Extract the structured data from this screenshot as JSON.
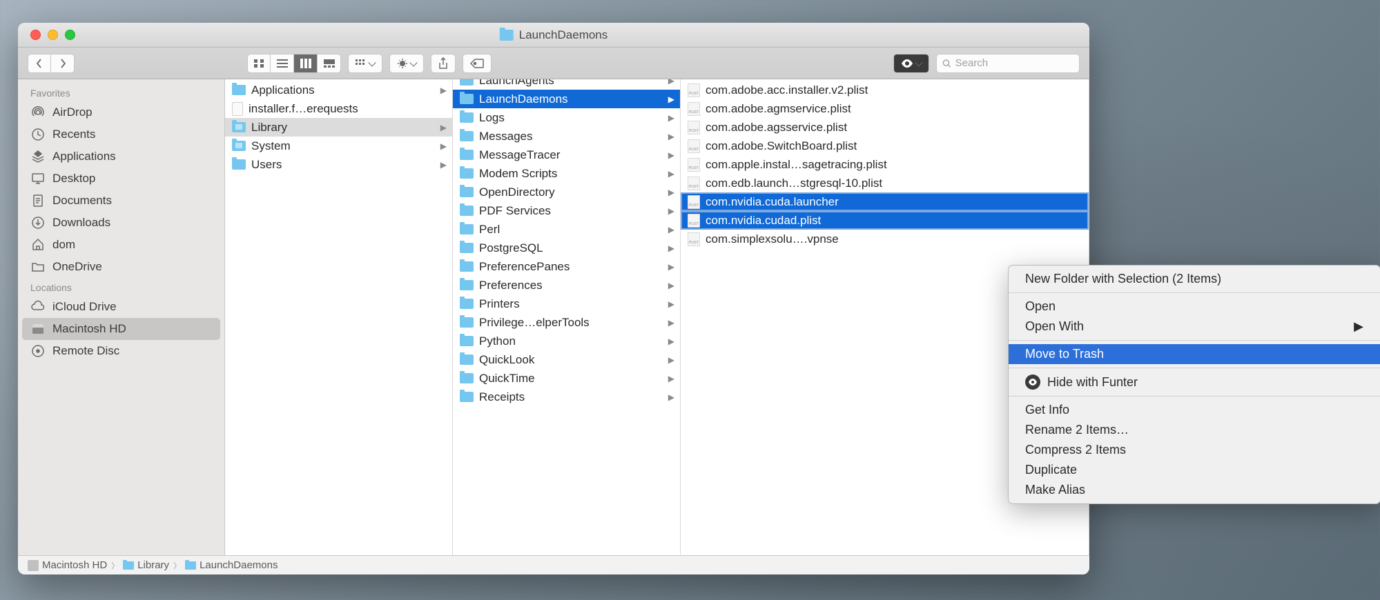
{
  "window": {
    "title": "LaunchDaemons"
  },
  "search": {
    "placeholder": "Search"
  },
  "sidebar": {
    "sections": [
      {
        "label": "Favorites",
        "items": [
          {
            "label": "AirDrop",
            "icon": "airdrop"
          },
          {
            "label": "Recents",
            "icon": "clock"
          },
          {
            "label": "Applications",
            "icon": "apps"
          },
          {
            "label": "Desktop",
            "icon": "desktop"
          },
          {
            "label": "Documents",
            "icon": "documents"
          },
          {
            "label": "Downloads",
            "icon": "downloads"
          },
          {
            "label": "dom",
            "icon": "home"
          },
          {
            "label": "OneDrive",
            "icon": "folder"
          }
        ]
      },
      {
        "label": "Locations",
        "items": [
          {
            "label": "iCloud Drive",
            "icon": "cloud"
          },
          {
            "label": "Macintosh HD",
            "icon": "disk",
            "selected": true
          },
          {
            "label": "Remote Disc",
            "icon": "remote"
          }
        ]
      }
    ]
  },
  "columns": {
    "col1": [
      {
        "label": "Applications",
        "type": "folder",
        "hasChild": true
      },
      {
        "label": "installer.f…erequests",
        "type": "file"
      },
      {
        "label": "Library",
        "type": "folder-sys",
        "hasChild": true,
        "selected": true
      },
      {
        "label": "System",
        "type": "folder-sys",
        "hasChild": true
      },
      {
        "label": "Users",
        "type": "folder",
        "hasChild": true
      }
    ],
    "col2": [
      {
        "label": "LaunchAgents",
        "type": "folder",
        "hasChild": true,
        "partial": true
      },
      {
        "label": "LaunchDaemons",
        "type": "folder",
        "hasChild": true,
        "hl": true
      },
      {
        "label": "Logs",
        "type": "folder",
        "hasChild": true
      },
      {
        "label": "Messages",
        "type": "folder",
        "hasChild": true
      },
      {
        "label": "MessageTracer",
        "type": "folder",
        "hasChild": true
      },
      {
        "label": "Modem Scripts",
        "type": "folder",
        "hasChild": true
      },
      {
        "label": "OpenDirectory",
        "type": "folder",
        "hasChild": true
      },
      {
        "label": "PDF Services",
        "type": "folder",
        "hasChild": true
      },
      {
        "label": "Perl",
        "type": "folder",
        "hasChild": true
      },
      {
        "label": "PostgreSQL",
        "type": "folder",
        "hasChild": true
      },
      {
        "label": "PreferencePanes",
        "type": "folder",
        "hasChild": true
      },
      {
        "label": "Preferences",
        "type": "folder",
        "hasChild": true
      },
      {
        "label": "Printers",
        "type": "folder",
        "hasChild": true
      },
      {
        "label": "Privilege…elperTools",
        "type": "folder",
        "hasChild": true
      },
      {
        "label": "Python",
        "type": "folder",
        "hasChild": true
      },
      {
        "label": "QuickLook",
        "type": "folder",
        "hasChild": true
      },
      {
        "label": "QuickTime",
        "type": "folder",
        "hasChild": true
      },
      {
        "label": "Receipts",
        "type": "folder",
        "hasChild": true
      }
    ],
    "col3": [
      {
        "label": "com.adobe.acc.installer.v2.plist",
        "type": "plist"
      },
      {
        "label": "com.adobe.agmservice.plist",
        "type": "plist"
      },
      {
        "label": "com.adobe.agsservice.plist",
        "type": "plist"
      },
      {
        "label": "com.adobe.SwitchBoard.plist",
        "type": "plist"
      },
      {
        "label": "com.apple.instal…sagetracing.plist",
        "type": "plist"
      },
      {
        "label": "com.edb.launch…stgresql-10.plist",
        "type": "plist"
      },
      {
        "label": "com.nvidia.cuda.launcher",
        "type": "plist",
        "hl2": true
      },
      {
        "label": "com.nvidia.cudad.plist",
        "type": "plist",
        "hl2": true
      },
      {
        "label": "com.simplexsolu….vpnse",
        "type": "plist"
      }
    ]
  },
  "pathbar": [
    {
      "label": "Macintosh HD",
      "icon": "disk"
    },
    {
      "label": "Library",
      "icon": "folder"
    },
    {
      "label": "LaunchDaemons",
      "icon": "folder"
    }
  ],
  "contextMenu": {
    "groups": [
      [
        {
          "label": "New Folder with Selection (2 Items)"
        }
      ],
      [
        {
          "label": "Open"
        },
        {
          "label": "Open With",
          "submenu": true
        }
      ],
      [
        {
          "label": "Move to Trash",
          "hl": true
        }
      ],
      [
        {
          "label": "Hide with Funter",
          "icon": "eye"
        }
      ],
      [
        {
          "label": "Get Info"
        },
        {
          "label": "Rename 2 Items…"
        },
        {
          "label": "Compress 2 Items"
        },
        {
          "label": "Duplicate"
        },
        {
          "label": "Make Alias"
        }
      ]
    ]
  }
}
